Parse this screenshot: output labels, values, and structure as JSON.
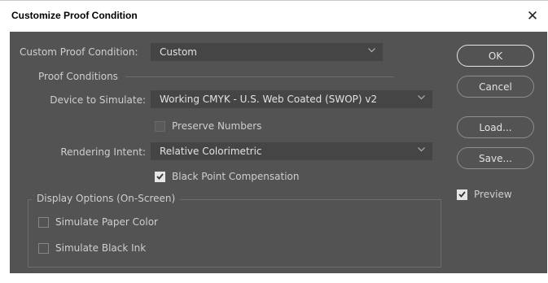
{
  "window": {
    "title": "Customize Proof Condition"
  },
  "custom_proof_condition": {
    "label": "Custom Proof Condition:",
    "value": "Custom"
  },
  "proof_conditions": {
    "group_title": "Proof Conditions",
    "device_label": "Device to Simulate:",
    "device_value": "Working CMYK - U.S. Web Coated (SWOP) v2",
    "preserve_numbers": {
      "label": "Preserve Numbers",
      "checked": false,
      "enabled": false
    },
    "rendering_intent_label": "Rendering Intent:",
    "rendering_intent_value": "Relative Colorimetric",
    "black_point": {
      "label": "Black Point Compensation",
      "checked": true
    }
  },
  "display_options": {
    "group_title": "Display Options (On-Screen)",
    "simulate_paper": {
      "label": "Simulate Paper Color",
      "checked": false
    },
    "simulate_ink": {
      "label": "Simulate Black Ink",
      "checked": false
    }
  },
  "buttons": {
    "ok": "OK",
    "cancel": "Cancel",
    "load": "Load...",
    "save": "Save..."
  },
  "preview": {
    "label": "Preview",
    "checked": true
  },
  "colors": {
    "dialog_bg": "#535353",
    "field_bg": "#454545",
    "text": "#cfcfcf"
  }
}
